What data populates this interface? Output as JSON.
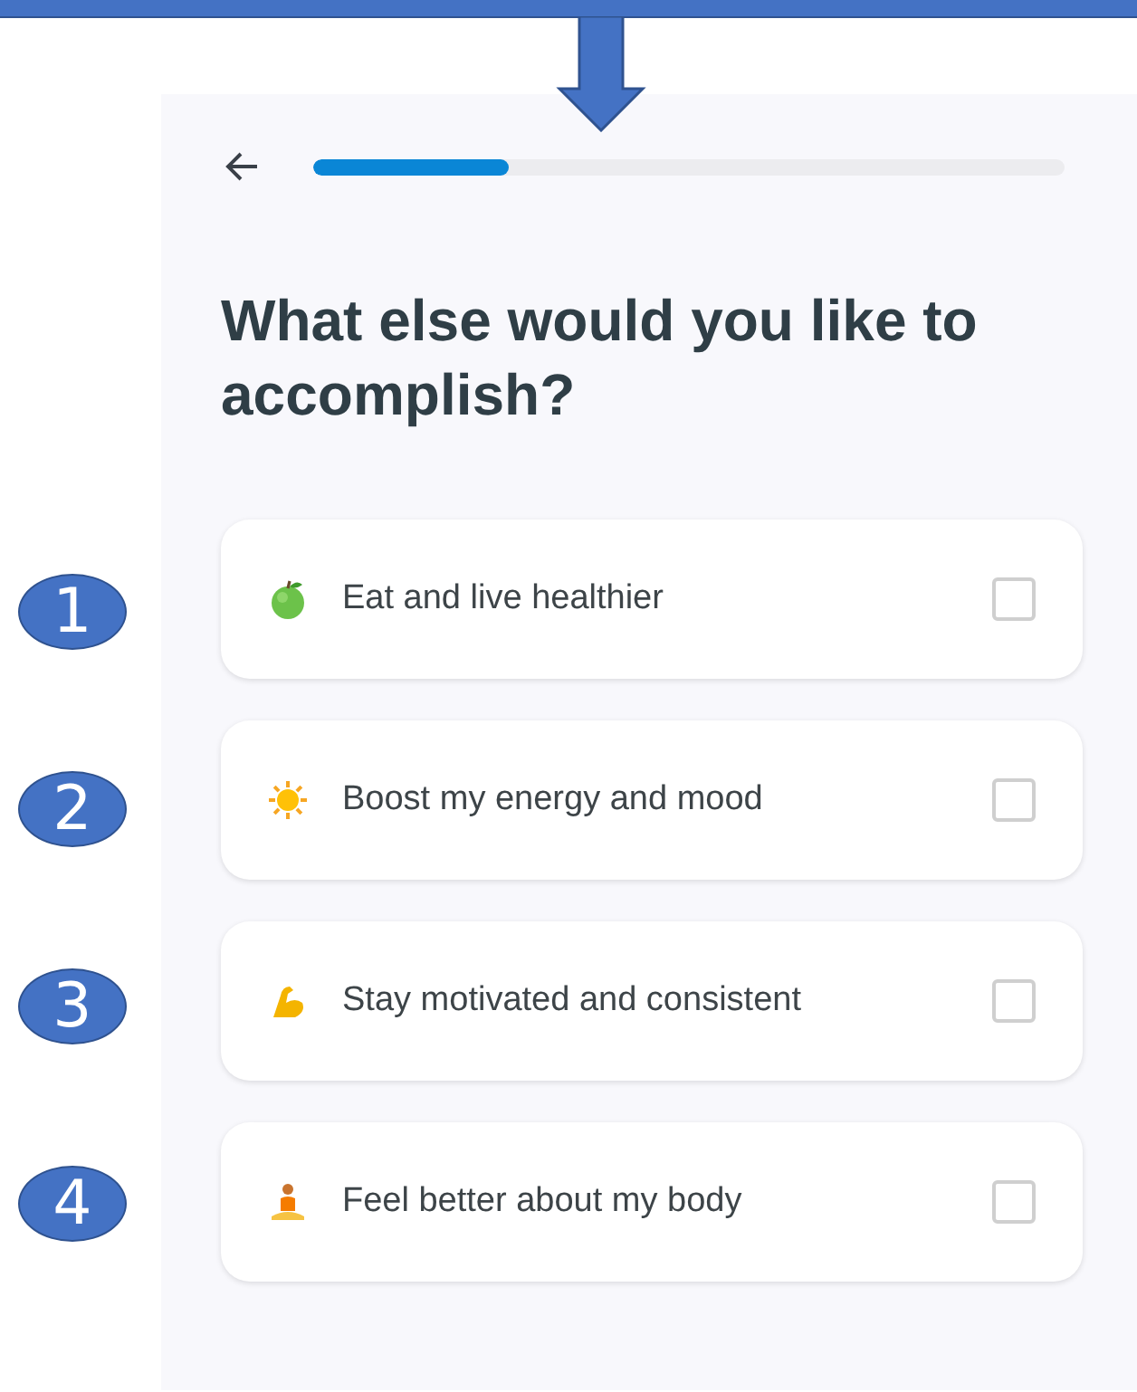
{
  "annotation": {
    "markers": [
      "1",
      "2",
      "3",
      "4"
    ]
  },
  "header": {
    "progress": {
      "level": 0.26
    }
  },
  "title": "What else would you like to accomplish?",
  "options": [
    {
      "label": "Eat and live healthier",
      "checked": false
    },
    {
      "label": "Boost my energy and mood",
      "checked": false
    },
    {
      "label": "Stay motivated and consistent",
      "checked": false
    },
    {
      "label": "Feel better about my body",
      "checked": false
    }
  ]
}
